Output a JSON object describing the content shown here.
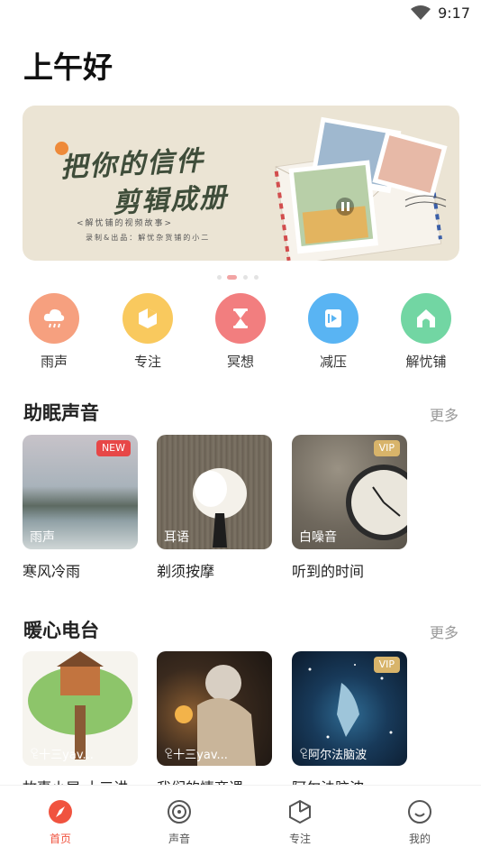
{
  "status_bar": {
    "time": "9:17",
    "wifi_icon": "wifi-icon"
  },
  "greeting": "上午好",
  "banner": {
    "line1": "把你的信件",
    "line2": "剪辑成册",
    "sub1": "<解忧铺的视频故事>",
    "sub2": "录制&出品：解忧杂货铺的小二",
    "pager": {
      "count": 5,
      "active_index": 1
    }
  },
  "categories": [
    {
      "label": "雨声",
      "icon": "rain-cloud-icon",
      "color": "#f6a07f"
    },
    {
      "label": "专注",
      "icon": "focus-icon",
      "color": "#f9c95e"
    },
    {
      "label": "冥想",
      "icon": "hourglass-icon",
      "color": "#f27e7f"
    },
    {
      "label": "减压",
      "icon": "video-icon",
      "color": "#59b4f3"
    },
    {
      "label": "解忧铺",
      "icon": "home-icon",
      "color": "#72d6a3"
    }
  ],
  "sections": {
    "sleep": {
      "title": "助眠声音",
      "more": "更多",
      "cards": [
        {
          "title": "寒风冷雨",
          "tag": "雨声",
          "badge": "NEW"
        },
        {
          "title": "剃须按摩",
          "tag": "耳语",
          "badge": ""
        },
        {
          "title": "听到的时间",
          "tag": "白噪音",
          "badge": "VIP"
        }
      ]
    },
    "radio": {
      "title": "暖心电台",
      "more": "更多",
      "cards": [
        {
          "title": "故事小屋 十三讲",
          "author": "十三yav...",
          "badge": ""
        },
        {
          "title": "我们的情商课",
          "author": "十三yav...",
          "badge": ""
        },
        {
          "title": "阿尔法脑波",
          "author": "阿尔法脑波",
          "badge": "VIP"
        }
      ]
    }
  },
  "tabbar": {
    "active_color": "#f0533f",
    "tabs": [
      {
        "label": "首页",
        "icon": "compass-icon",
        "active": true
      },
      {
        "label": "声音",
        "icon": "disc-icon",
        "active": false
      },
      {
        "label": "专注",
        "icon": "hexagon-icon",
        "active": false
      },
      {
        "label": "我的",
        "icon": "smile-icon",
        "active": false
      }
    ]
  }
}
